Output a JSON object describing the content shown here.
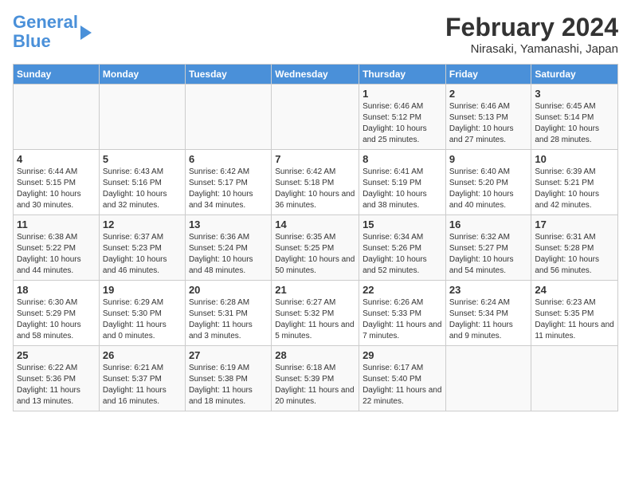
{
  "header": {
    "logo_line1": "General",
    "logo_line2": "Blue",
    "month_title": "February 2024",
    "location": "Nirasaki, Yamanashi, Japan"
  },
  "weekdays": [
    "Sunday",
    "Monday",
    "Tuesday",
    "Wednesday",
    "Thursday",
    "Friday",
    "Saturday"
  ],
  "weeks": [
    [
      {
        "day": "",
        "info": ""
      },
      {
        "day": "",
        "info": ""
      },
      {
        "day": "",
        "info": ""
      },
      {
        "day": "",
        "info": ""
      },
      {
        "day": "1",
        "info": "Sunrise: 6:46 AM\nSunset: 5:12 PM\nDaylight: 10 hours and 25 minutes."
      },
      {
        "day": "2",
        "info": "Sunrise: 6:46 AM\nSunset: 5:13 PM\nDaylight: 10 hours and 27 minutes."
      },
      {
        "day": "3",
        "info": "Sunrise: 6:45 AM\nSunset: 5:14 PM\nDaylight: 10 hours and 28 minutes."
      }
    ],
    [
      {
        "day": "4",
        "info": "Sunrise: 6:44 AM\nSunset: 5:15 PM\nDaylight: 10 hours and 30 minutes."
      },
      {
        "day": "5",
        "info": "Sunrise: 6:43 AM\nSunset: 5:16 PM\nDaylight: 10 hours and 32 minutes."
      },
      {
        "day": "6",
        "info": "Sunrise: 6:42 AM\nSunset: 5:17 PM\nDaylight: 10 hours and 34 minutes."
      },
      {
        "day": "7",
        "info": "Sunrise: 6:42 AM\nSunset: 5:18 PM\nDaylight: 10 hours and 36 minutes."
      },
      {
        "day": "8",
        "info": "Sunrise: 6:41 AM\nSunset: 5:19 PM\nDaylight: 10 hours and 38 minutes."
      },
      {
        "day": "9",
        "info": "Sunrise: 6:40 AM\nSunset: 5:20 PM\nDaylight: 10 hours and 40 minutes."
      },
      {
        "day": "10",
        "info": "Sunrise: 6:39 AM\nSunset: 5:21 PM\nDaylight: 10 hours and 42 minutes."
      }
    ],
    [
      {
        "day": "11",
        "info": "Sunrise: 6:38 AM\nSunset: 5:22 PM\nDaylight: 10 hours and 44 minutes."
      },
      {
        "day": "12",
        "info": "Sunrise: 6:37 AM\nSunset: 5:23 PM\nDaylight: 10 hours and 46 minutes."
      },
      {
        "day": "13",
        "info": "Sunrise: 6:36 AM\nSunset: 5:24 PM\nDaylight: 10 hours and 48 minutes."
      },
      {
        "day": "14",
        "info": "Sunrise: 6:35 AM\nSunset: 5:25 PM\nDaylight: 10 hours and 50 minutes."
      },
      {
        "day": "15",
        "info": "Sunrise: 6:34 AM\nSunset: 5:26 PM\nDaylight: 10 hours and 52 minutes."
      },
      {
        "day": "16",
        "info": "Sunrise: 6:32 AM\nSunset: 5:27 PM\nDaylight: 10 hours and 54 minutes."
      },
      {
        "day": "17",
        "info": "Sunrise: 6:31 AM\nSunset: 5:28 PM\nDaylight: 10 hours and 56 minutes."
      }
    ],
    [
      {
        "day": "18",
        "info": "Sunrise: 6:30 AM\nSunset: 5:29 PM\nDaylight: 10 hours and 58 minutes."
      },
      {
        "day": "19",
        "info": "Sunrise: 6:29 AM\nSunset: 5:30 PM\nDaylight: 11 hours and 0 minutes."
      },
      {
        "day": "20",
        "info": "Sunrise: 6:28 AM\nSunset: 5:31 PM\nDaylight: 11 hours and 3 minutes."
      },
      {
        "day": "21",
        "info": "Sunrise: 6:27 AM\nSunset: 5:32 PM\nDaylight: 11 hours and 5 minutes."
      },
      {
        "day": "22",
        "info": "Sunrise: 6:26 AM\nSunset: 5:33 PM\nDaylight: 11 hours and 7 minutes."
      },
      {
        "day": "23",
        "info": "Sunrise: 6:24 AM\nSunset: 5:34 PM\nDaylight: 11 hours and 9 minutes."
      },
      {
        "day": "24",
        "info": "Sunrise: 6:23 AM\nSunset: 5:35 PM\nDaylight: 11 hours and 11 minutes."
      }
    ],
    [
      {
        "day": "25",
        "info": "Sunrise: 6:22 AM\nSunset: 5:36 PM\nDaylight: 11 hours and 13 minutes."
      },
      {
        "day": "26",
        "info": "Sunrise: 6:21 AM\nSunset: 5:37 PM\nDaylight: 11 hours and 16 minutes."
      },
      {
        "day": "27",
        "info": "Sunrise: 6:19 AM\nSunset: 5:38 PM\nDaylight: 11 hours and 18 minutes."
      },
      {
        "day": "28",
        "info": "Sunrise: 6:18 AM\nSunset: 5:39 PM\nDaylight: 11 hours and 20 minutes."
      },
      {
        "day": "29",
        "info": "Sunrise: 6:17 AM\nSunset: 5:40 PM\nDaylight: 11 hours and 22 minutes."
      },
      {
        "day": "",
        "info": ""
      },
      {
        "day": "",
        "info": ""
      }
    ]
  ]
}
